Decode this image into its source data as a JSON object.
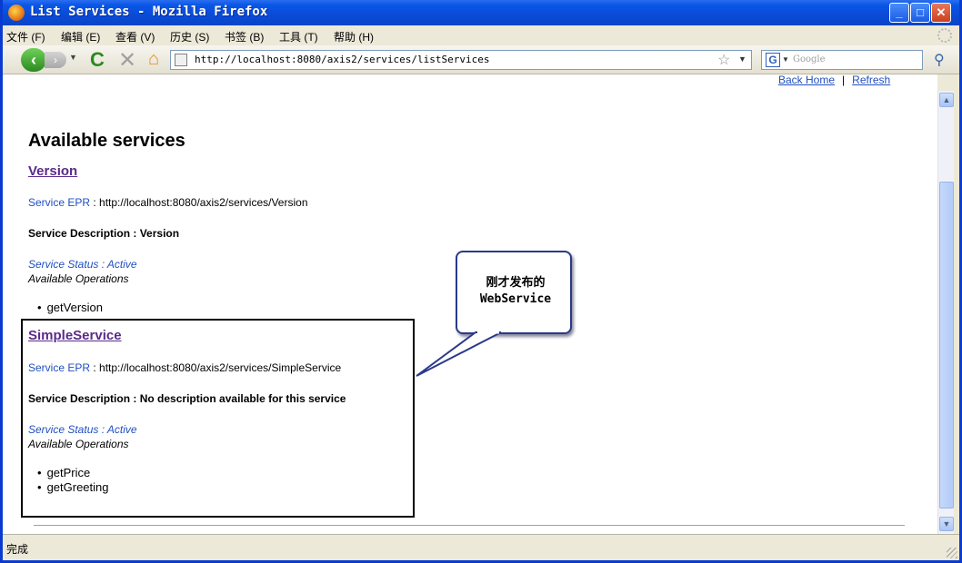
{
  "window": {
    "title": "List Services - Mozilla Firefox",
    "icon": "firefox-icon"
  },
  "menu": {
    "items": [
      "文件 (F)",
      "编辑 (E)",
      "查看 (V)",
      "历史 (S)",
      "书签 (B)",
      "工具 (T)",
      "帮助 (H)"
    ]
  },
  "toolbar": {
    "url": "http://localhost:8080/axis2/services/listServices",
    "search_placeholder": "Google",
    "search_engine_icon": "G"
  },
  "page": {
    "links": {
      "back_home": "Back Home",
      "separator": "|",
      "refresh": "Refresh"
    },
    "heading": "Available services",
    "services": [
      {
        "name": "Version",
        "epr_label": "Service EPR",
        "epr_value": " : http://localhost:8080/axis2/services/Version",
        "description": "Service Description : Version",
        "status": "Service Status : Active",
        "ops_title": "Available Operations",
        "operations": [
          "getVersion"
        ]
      },
      {
        "name": "SimpleService",
        "epr_label": "Service EPR",
        "epr_value": " : http://localhost:8080/axis2/services/SimpleService",
        "description": "Service Description : No description available for this service",
        "status": "Service Status : Active",
        "ops_title": "Available Operations",
        "operations": [
          "getPrice",
          "getGreeting"
        ]
      }
    ]
  },
  "annotation": {
    "line1": "刚才发布的",
    "line2": "WebService"
  },
  "statusbar": {
    "text": "完成"
  }
}
